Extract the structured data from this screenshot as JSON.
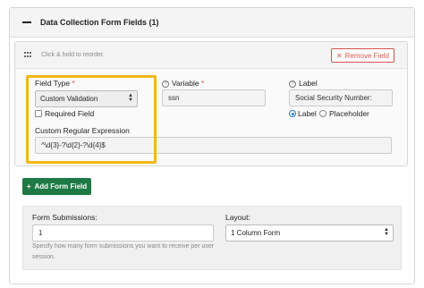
{
  "section": {
    "collapse_icon": "minus-icon",
    "title": "Data Collection Form Fields (1)"
  },
  "field_card": {
    "reorder_hint": "Click & hold to reorder.",
    "remove_label": "Remove Field",
    "field_type": {
      "label": "Field Type",
      "required_mark": "*",
      "value": "Custom Validation"
    },
    "required_checkbox_label": "Required Field",
    "regex": {
      "label": "Custom Regular Expression",
      "value": "^\\d{3}-?\\d{2}-?\\d{4}$"
    },
    "variable": {
      "label": "Variable",
      "required_mark": "*",
      "value": "ssn"
    },
    "label_field": {
      "label": "Label",
      "value": "Social Security Number:"
    },
    "display_options": {
      "option_label": "Label",
      "option_placeholder": "Placeholder",
      "selected": "Label"
    }
  },
  "add_button": {
    "label": "Add Form Field",
    "icon": "plus-icon"
  },
  "form_settings": {
    "submissions": {
      "label": "Form Submissions:",
      "value": "1",
      "help_line1": "Specify how many form submissions you want to receive per user",
      "help_line2": "session."
    },
    "layout": {
      "label": "Layout:",
      "value": "1 Column Form"
    }
  },
  "colors": {
    "highlight": "#f3b814",
    "primary": "#1e7a45",
    "danger": "#d9534f"
  }
}
